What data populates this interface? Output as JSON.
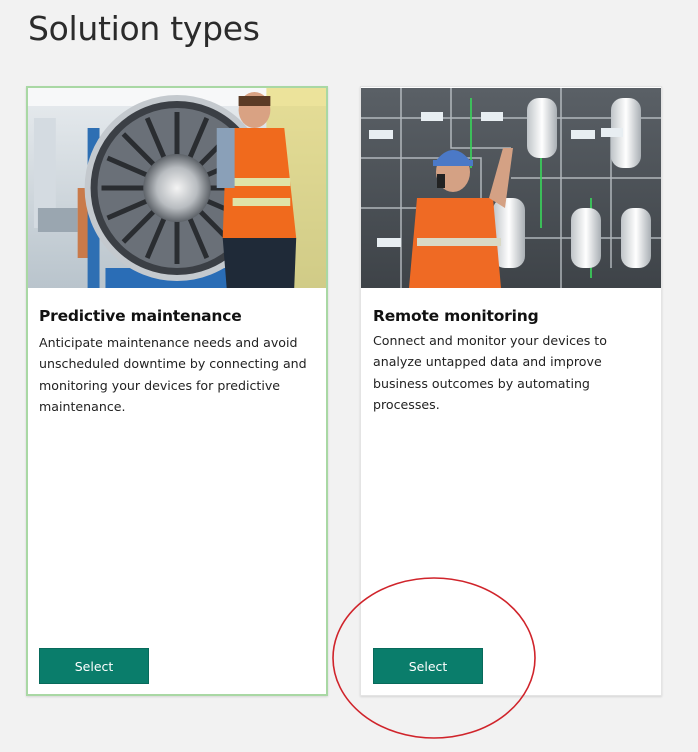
{
  "page": {
    "title": "Solution types"
  },
  "cards": [
    {
      "id": "predictive-maintenance",
      "title": "Predictive maintenance",
      "description": "Anticipate maintenance needs and avoid unscheduled downtime by connecting and monitoring your devices for predictive maintenance.",
      "button_label": "Select",
      "selected": true,
      "image": "jet-engine-worker-photo"
    },
    {
      "id": "remote-monitoring",
      "title": "Remote monitoring",
      "description": "Connect and monitor your devices to analyze untapped data and improve business outcomes by automating processes.",
      "button_label": "Select",
      "selected": false,
      "image": "control-panel-worker-photo"
    }
  ],
  "colors": {
    "background": "#f2f2f2",
    "button": "#0a7d6b",
    "selected_border": "#a9d8a4",
    "annotation": "#d0242b"
  }
}
